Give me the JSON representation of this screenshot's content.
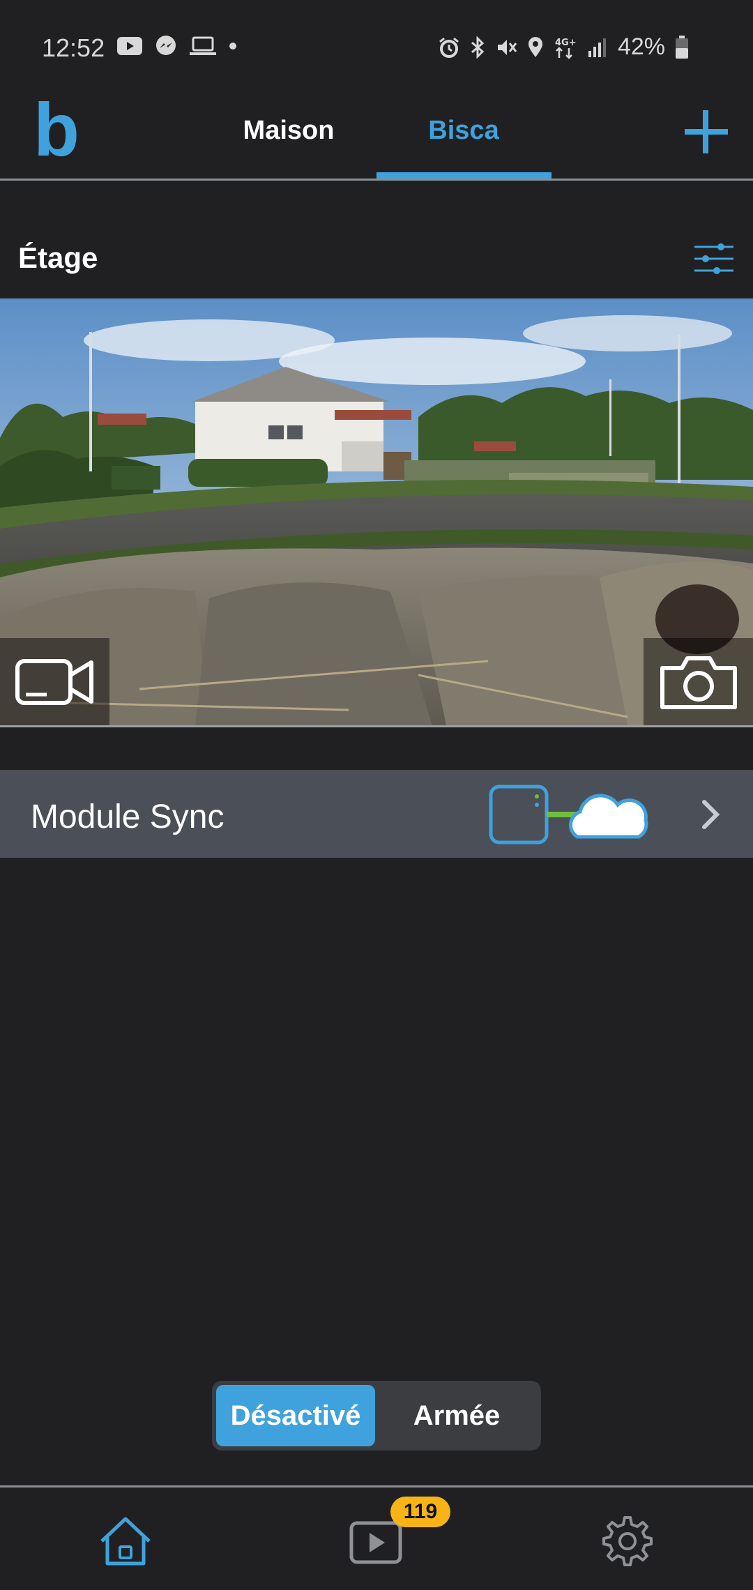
{
  "status_bar": {
    "time": "12:52",
    "battery": "42%",
    "network": "4G+"
  },
  "header": {
    "logo": "b",
    "tabs": [
      {
        "label": "Maison",
        "active": false
      },
      {
        "label": "Bisca",
        "active": true
      }
    ]
  },
  "section": {
    "title": "Étage"
  },
  "sync_module": {
    "label": "Module Sync"
  },
  "arm_toggle": {
    "off_label": "Désactivé",
    "on_label": "Armée",
    "selected": "off"
  },
  "bottom_nav": {
    "clips_badge": "119"
  },
  "colors": {
    "accent": "#3fa2dc",
    "background": "#202022",
    "row_bg": "#4a4f58",
    "badge": "#f6b416",
    "sync_link": "#6fbf3f"
  },
  "icons": [
    "youtube-icon",
    "messenger-icon",
    "laptop-icon",
    "alarm-icon",
    "bluetooth-icon",
    "mute-icon",
    "location-icon",
    "signal-icon",
    "battery-icon",
    "add-icon",
    "filter-icon",
    "video-camera-icon",
    "camera-icon",
    "sync-module-icon",
    "cloud-icon",
    "chevron-right-icon",
    "home-icon",
    "play-icon",
    "gear-icon"
  ]
}
